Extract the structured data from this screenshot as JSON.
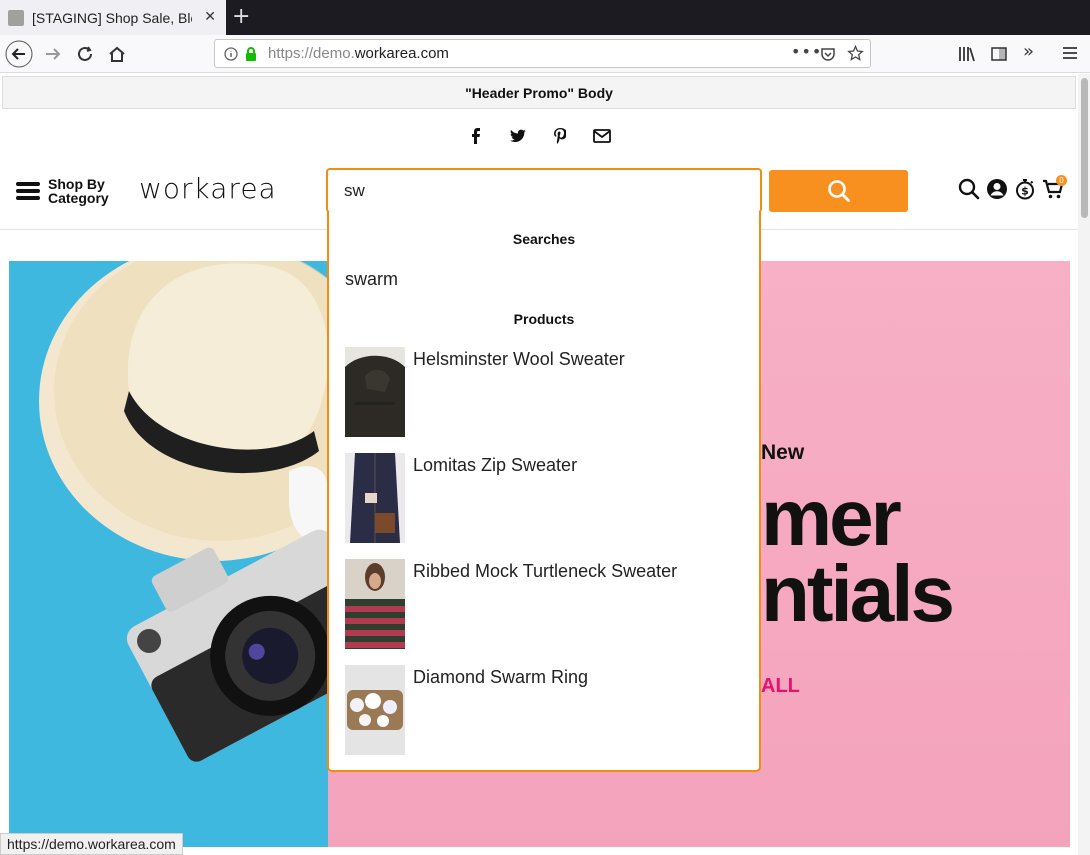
{
  "browser": {
    "tab_title": "[STAGING] Shop Sale, Blo",
    "url_scheme": "https://demo.",
    "url_host": "workarea.com",
    "status_url": "https://demo.workarea.com"
  },
  "promo": {
    "text": "\"Header Promo\" Body"
  },
  "header": {
    "shop_by_line1": "Shop By",
    "shop_by_line2": "Category",
    "logo": "workarea",
    "search_value": "sw",
    "cart_count": "0"
  },
  "autocomplete": {
    "searches_heading": "Searches",
    "searches": [
      "swarm"
    ],
    "products_heading": "Products",
    "products": [
      {
        "name": "Helsminster Wool Sweater"
      },
      {
        "name": "Lomitas Zip Sweater"
      },
      {
        "name": "Ribbed Mock Turtleneck Sweater"
      },
      {
        "name": "Diamond Swarm Ring"
      }
    ]
  },
  "hero": {
    "eyebrow": "New",
    "line1": "mer",
    "line2": "ntials",
    "cta": "ALL"
  },
  "colors": {
    "accent": "#f7901e",
    "hero_left": "#3fb8e0",
    "hero_right": "#f4a3bc",
    "cta": "#e5136f"
  }
}
